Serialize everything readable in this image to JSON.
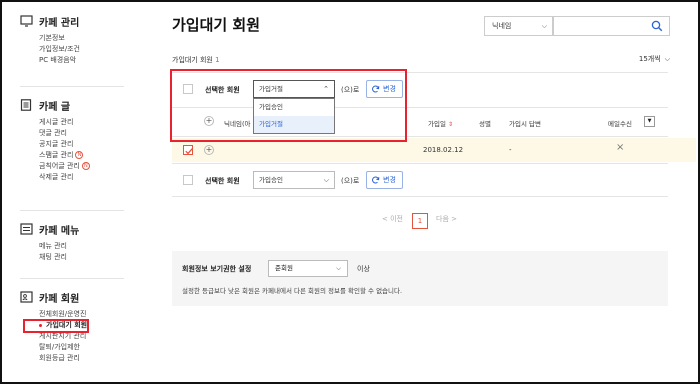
{
  "sidebar": {
    "sections": [
      {
        "title": "카페 관리",
        "icon": "monitor-icon",
        "items": [
          "기본정보",
          "가입정보/조건",
          "PC 배경음악"
        ]
      },
      {
        "title": "카페 글",
        "icon": "document-icon",
        "items": [
          "게시글 관리",
          "댓글 관리",
          "공지글 관리",
          "스팸글 관리",
          "금칙어글 관리",
          "삭제글 관리"
        ]
      },
      {
        "title": "카페 메뉴",
        "icon": "menu-list-icon",
        "items": [
          "메뉴 관리",
          "채팅 관리"
        ]
      },
      {
        "title": "카페 회원",
        "icon": "member-card-icon",
        "items": [
          "전체회원/운영진",
          "가입대기 회원",
          "게시판지기 관리",
          "탈퇴/가입제한",
          "회원등급 관리"
        ]
      }
    ],
    "new_badge": "N",
    "active_item": "가입대기 회원"
  },
  "header": {
    "title": "가입대기 회원",
    "search_scope": "닉네임",
    "search_placeholder": ""
  },
  "list": {
    "subtitle": "가입대기 회원",
    "count": "1",
    "per_page": "15개씩",
    "top_bar": {
      "selected_label": "선택한 회원",
      "dropdown_value": "가입거절",
      "suffix": "(으)로",
      "change_button": "변경"
    },
    "dropdown_options": [
      "가입승인",
      "가입거절"
    ],
    "columns": [
      "닉네임(아",
      "가입일",
      "성별",
      "가입시 답변",
      "메일수신"
    ],
    "rows": [
      {
        "date": "2018.02.12",
        "gender": "",
        "answer": "-",
        "mail": "×"
      }
    ],
    "bottom_bar": {
      "selected_label": "선택한 회원",
      "dropdown_value": "가입승인",
      "suffix": "(으)로",
      "change_button": "변경"
    },
    "pagination": {
      "prev": "< 이전",
      "current": "1",
      "next": "다음 >"
    }
  },
  "settings": {
    "label": "회원정보 보기권한 설정",
    "value": "준회원",
    "suffix": "이상",
    "description": "설정한 등급보다 낮은 회원은 카페내에서 다른 회원의 정보를 확인할 수 없습니다."
  },
  "colors": {
    "accent": "#e5533d",
    "highlight_box": "#e8232f",
    "link_blue": "#2a62d6",
    "row_highlight": "#fdf9e6"
  }
}
